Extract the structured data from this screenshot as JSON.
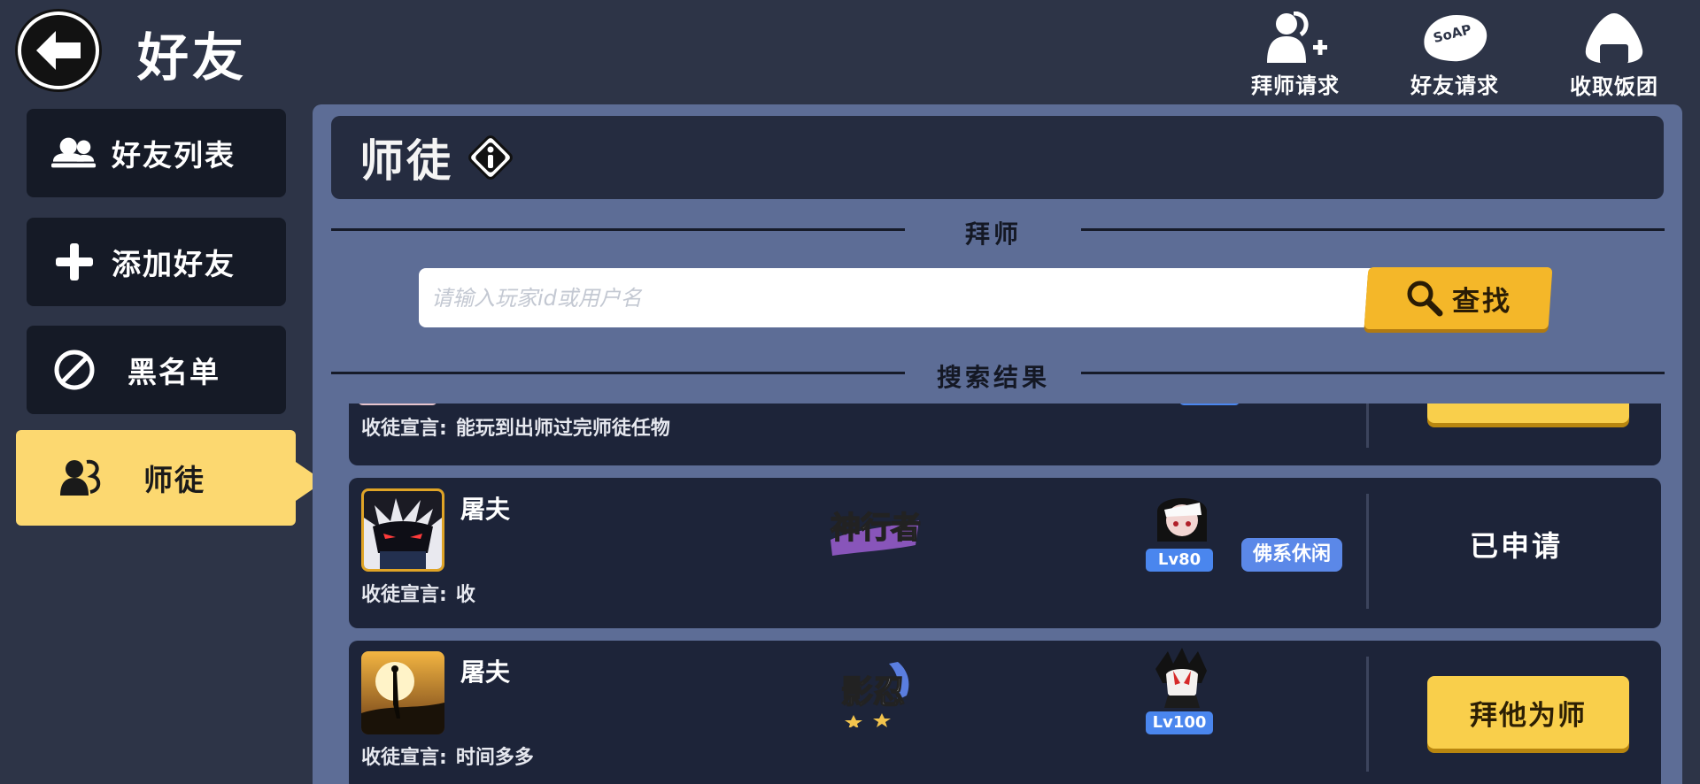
{
  "header": {
    "title": "好友",
    "actions": [
      {
        "label": "拜师请求",
        "icon": "add-mentor-icon"
      },
      {
        "label": "好友请求",
        "icon": "soap-request-icon"
      },
      {
        "label": "收取饭团",
        "icon": "rice-ball-icon"
      }
    ]
  },
  "sidebar": {
    "items": [
      {
        "label": "好友列表",
        "icon": "friends-icon"
      },
      {
        "label": "添加好友",
        "icon": "plus-icon"
      },
      {
        "label": "黑名单",
        "icon": "ban-icon"
      },
      {
        "label": "师徒",
        "icon": "mentor-icon",
        "active": true
      }
    ]
  },
  "panel": {
    "title": "师徒",
    "mentor_section_label": "拜师",
    "search": {
      "placeholder": "请输入玩家id或用户名",
      "button_label": "查找"
    },
    "results_label": "搜索结果"
  },
  "results": [
    {
      "name": "",
      "declaration_label": "收徒宣言:",
      "declaration": "能玩到出师过完师徒任物",
      "partial": true
    },
    {
      "name": "屠夫",
      "class_logo": "神行者",
      "level": "Lv80",
      "tag": "佛系休闲",
      "declaration_label": "收徒宣言:",
      "declaration": "收",
      "status": "已申请"
    },
    {
      "name": "屠夫",
      "class_logo": "影忍",
      "level": "Lv100",
      "declaration_label": "收徒宣言:",
      "declaration": "时间多多",
      "action_label": "拜他为师"
    }
  ],
  "colors": {
    "background": "#2d3447",
    "panel": "#5d6d96",
    "card": "#1d2439",
    "accent_yellow": "#fcd870",
    "button_gold": "#f4b729",
    "level_blue": "#4a86ee"
  }
}
